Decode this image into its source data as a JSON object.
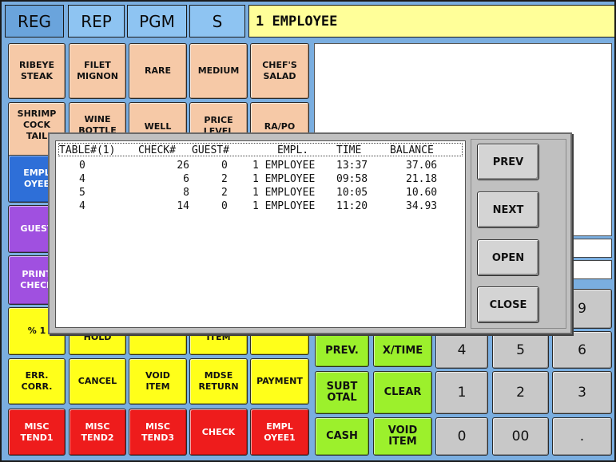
{
  "tabs": [
    "REG",
    "REP",
    "PGM",
    "S"
  ],
  "title": "1 EMPLOYEE",
  "left_keys": [
    [
      "RIBEYE\nSTEAK",
      "FILET\nMIGNON",
      "RARE",
      "MEDIUM",
      "CHEF'S\nSALAD"
    ],
    [
      "SHRIMP\nCOCK\nTAIL",
      "WINE\nBOTTLE",
      "WELL",
      "PRICE\nLEVEL",
      "RA/PO"
    ],
    [
      "EMPL\nOYEE"
    ],
    [
      "GUEST"
    ],
    [
      "PRINT\nCHECK"
    ],
    [
      "% 1",
      "HOLD",
      "",
      "ITEM",
      ""
    ],
    [
      "ERR.\nCORR.",
      "CANCEL",
      "VOID\nITEM",
      "MDSE\nRETURN",
      "PAYMENT"
    ],
    [
      "MISC\nTEND1",
      "MISC\nTEND2",
      "MISC\nTEND3",
      "CHECK",
      "EMPL\nOYEE1"
    ]
  ],
  "function_keys": {
    "prev": "PREV.",
    "x_time": "X/TIME",
    "subtotal": "SUBT\nOTAL",
    "clear": "CLEAR",
    "cash": "CASH",
    "void_item": "VOID\nITEM"
  },
  "numpad": {
    "nine": "9",
    "four": "4",
    "five": "5",
    "six": "6",
    "one": "1",
    "two": "2",
    "three": "3",
    "zero": "0",
    "double_zero": "00",
    "dot": "."
  },
  "dialog": {
    "columns": [
      "TABLE#(1)",
      "CHECK#",
      "GUEST#",
      "EMPL.",
      "TIME",
      "BALANCE"
    ],
    "rows": [
      {
        "table": "0",
        "check": "26",
        "guest": "0",
        "employee": "1 EMPLOYEE",
        "time": "13:37",
        "balance": "37.06"
      },
      {
        "table": "4",
        "check": "6",
        "guest": "2",
        "employee": "1 EMPLOYEE",
        "time": "09:58",
        "balance": "21.18"
      },
      {
        "table": "5",
        "check": "8",
        "guest": "2",
        "employee": "1 EMPLOYEE",
        "time": "10:05",
        "balance": "10.60"
      },
      {
        "table": "4",
        "check": "14",
        "guest": "0",
        "employee": "1 EMPLOYEE",
        "time": "11:20",
        "balance": "34.93"
      }
    ],
    "buttons": {
      "prev": "PREV",
      "next": "NEXT",
      "open": "OPEN",
      "close": "CLOSE"
    }
  },
  "colors": {
    "background": "#7aaee0",
    "title_bar": "#ffff99",
    "menu_key": "#f6c9a7",
    "employee_key": "#2e6fd8",
    "guest_key": "#a050e0",
    "function_key": "#ffff1a",
    "tender_key": "#ee1c1c",
    "action_key": "#9cf02c",
    "numpad_key": "#c8c8c8"
  }
}
